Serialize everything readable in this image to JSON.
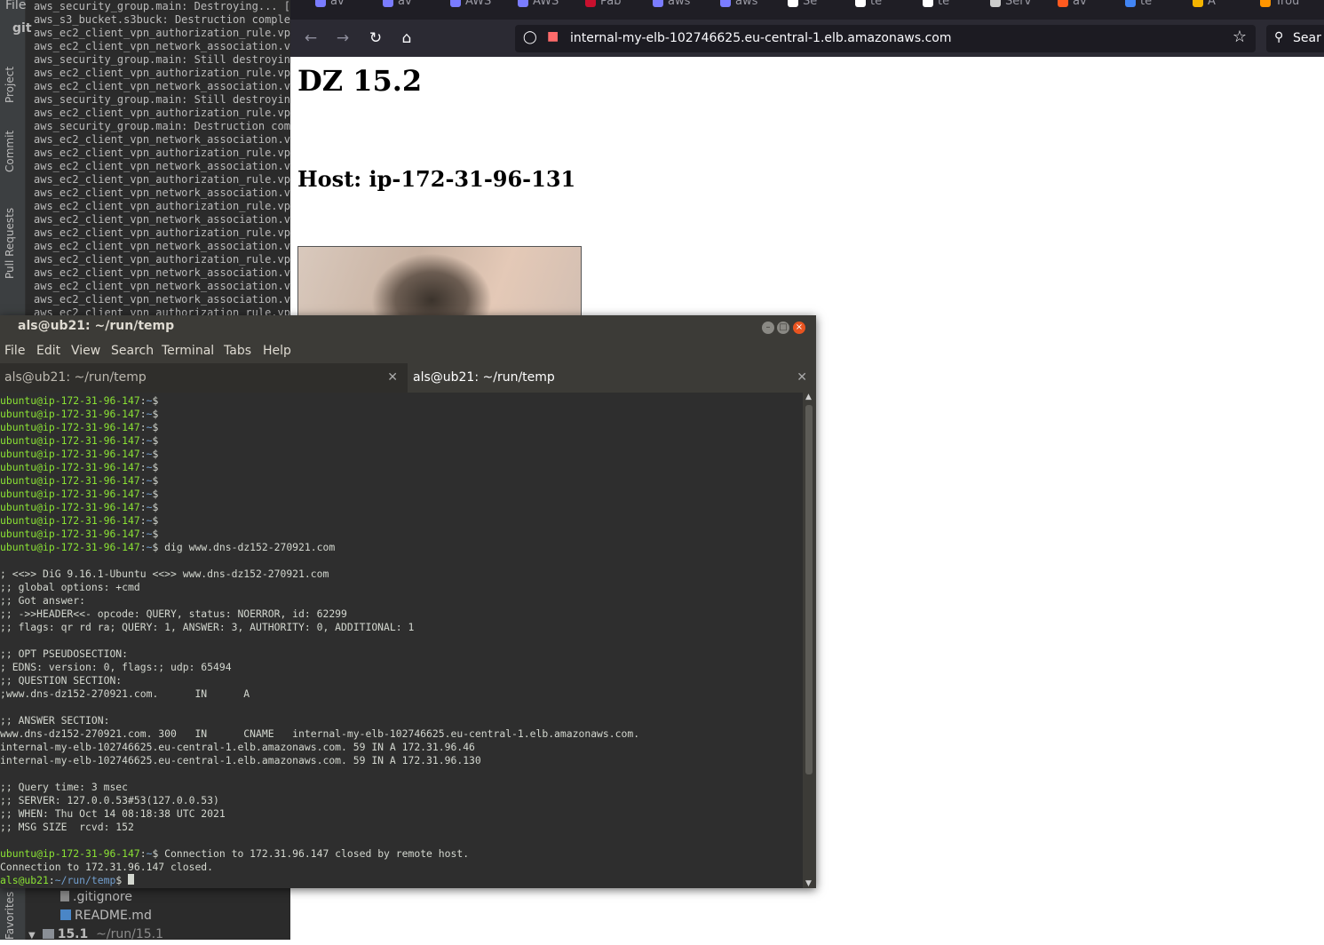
{
  "ide": {
    "file_menu": "File",
    "git_label": "git",
    "side_tabs": [
      "Project",
      "Commit",
      "Pull Requests",
      "Favorites"
    ],
    "console_lines": [
      "aws_security_group.main: Destroying... [i",
      "aws_s3_bucket.s3buck: Destruction complet",
      "aws_ec2_client_vpn_authorization_rule.vpn",
      "aws_ec2_client_vpn_network_association.vp",
      "aws_security_group.main: Still destroying",
      "aws_ec2_client_vpn_authorization_rule.vpn",
      "aws_ec2_client_vpn_network_association.vp",
      "aws_security_group.main: Still destroying",
      "aws_ec2_client_vpn_authorization_rule.vpn",
      "aws_security_group.main: Destruction comp",
      "aws_ec2_client_vpn_network_association.vp",
      "aws_ec2_client_vpn_authorization_rule.vpn",
      "aws_ec2_client_vpn_network_association.vp",
      "aws_ec2_client_vpn_authorization_rule.vpn",
      "aws_ec2_client_vpn_network_association.vp",
      "aws_ec2_client_vpn_authorization_rule.vpn",
      "aws_ec2_client_vpn_network_association.vp",
      "aws_ec2_client_vpn_authorization_rule.vpn",
      "aws_ec2_client_vpn_network_association.vp",
      "aws_ec2_client_vpn_authorization_rule.vpn",
      "aws_ec2_client_vpn_network_association.vp",
      "aws_ec2_client_vpn_network_association.vp",
      "aws_ec2_client_vpn_network_association.vp",
      "aws_ec2_client_vpn_authorization_rule.vpn"
    ],
    "tree": {
      "gitignore": ".gitignore",
      "readme": "README.md",
      "folder_name": "15.1",
      "folder_path": "~/run/15.1"
    }
  },
  "browser": {
    "tabs": [
      {
        "label": "av",
        "color": "#7a7cff"
      },
      {
        "label": "av",
        "color": "#7a7cff"
      },
      {
        "label": "AWS",
        "color": "#7a7cff"
      },
      {
        "label": "AWS",
        "color": "#7a7cff"
      },
      {
        "label": "Pab",
        "color": "#c8102e"
      },
      {
        "label": "aws",
        "color": "#7a7cff"
      },
      {
        "label": "aws",
        "color": "#7a7cff"
      },
      {
        "label": "Se",
        "color": "#ffffff"
      },
      {
        "label": "te",
        "color": "#ffffff"
      },
      {
        "label": "te",
        "color": "#ffffff"
      },
      {
        "label": "Serv",
        "color": "#cccccc"
      },
      {
        "label": "av",
        "color": "#ff5a1f"
      },
      {
        "label": "te",
        "color": "#4285f4"
      },
      {
        "label": "A",
        "color": "#f4b400"
      },
      {
        "label": "Trou",
        "color": "#ff9500"
      }
    ],
    "url": "internal-my-elb-102746625.eu-central-1.elb.amazonaws.com",
    "search_placeholder": "Sear",
    "page": {
      "heading": "DZ 15.2",
      "host": "Host: ip-172-31-96-131"
    }
  },
  "terminal": {
    "title": "als@ub21: ~/run/temp",
    "menu": [
      "File",
      "Edit",
      "View",
      "Search",
      "Terminal",
      "Tabs",
      "Help"
    ],
    "tabs": [
      "als@ub21: ~/run/temp",
      "als@ub21: ~/run/temp"
    ],
    "remote_user": "ubuntu@ip-172-31-96-147",
    "remote_path": "~",
    "local_user": "als@ub21",
    "local_path": "~/run/temp",
    "empty_prompt_count": 11,
    "dig_command": " dig www.dns-dz152-270921.com",
    "output": [
      "",
      "; <<>> DiG 9.16.1-Ubuntu <<>> www.dns-dz152-270921.com",
      ";; global options: +cmd",
      ";; Got answer:",
      ";; ->>HEADER<<- opcode: QUERY, status: NOERROR, id: 62299",
      ";; flags: qr rd ra; QUERY: 1, ANSWER: 3, AUTHORITY: 0, ADDITIONAL: 1",
      "",
      ";; OPT PSEUDOSECTION:",
      "; EDNS: version: 0, flags:; udp: 65494",
      ";; QUESTION SECTION:",
      ";www.dns-dz152-270921.com.      IN      A",
      "",
      ";; ANSWER SECTION:",
      "www.dns-dz152-270921.com. 300   IN      CNAME   internal-my-elb-102746625.eu-central-1.elb.amazonaws.com.",
      "internal-my-elb-102746625.eu-central-1.elb.amazonaws.com. 59 IN A 172.31.96.46",
      "internal-my-elb-102746625.eu-central-1.elb.amazonaws.com. 59 IN A 172.31.96.130",
      "",
      ";; Query time: 3 msec",
      ";; SERVER: 127.0.0.53#53(127.0.0.53)",
      ";; WHEN: Thu Oct 14 08:18:38 UTC 2021",
      ";; MSG SIZE  rcvd: 152",
      ""
    ],
    "closed_message": " Connection to 172.31.96.147 closed by remote host.",
    "closed_line": "Connection to 172.31.96.147 closed."
  }
}
